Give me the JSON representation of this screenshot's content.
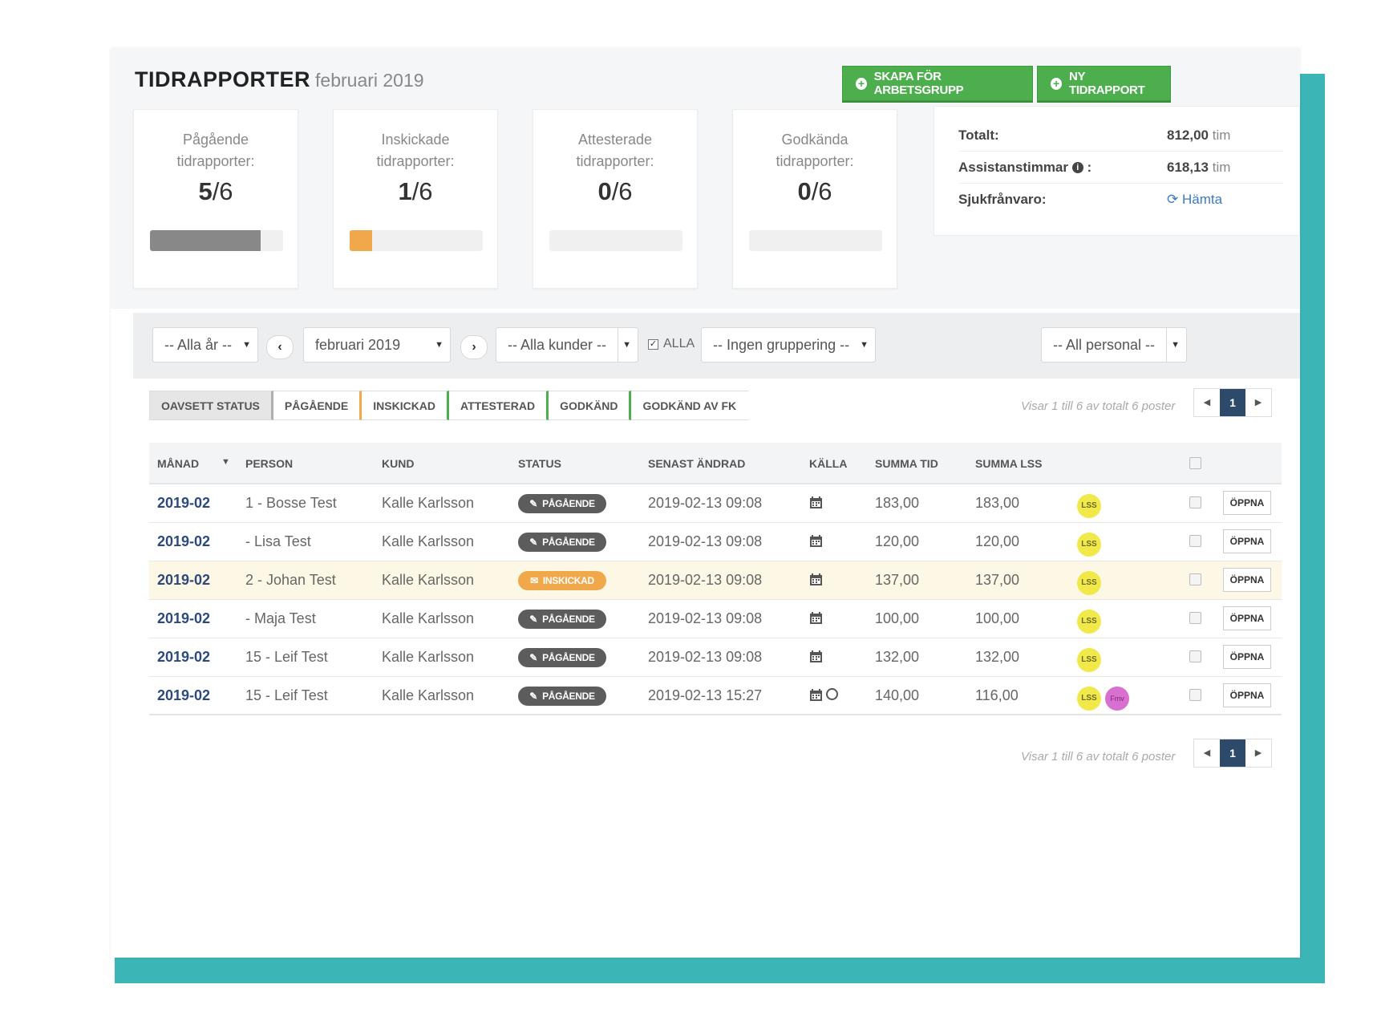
{
  "header": {
    "title": "TIDRAPPORTER",
    "period": "februari 2019",
    "btn_group": "SKAPA FÖR ARBETSGRUPP",
    "btn_new": "NY TIDRAPPORT"
  },
  "stats": [
    {
      "label": "Pågående tidrapporter:",
      "done": "5",
      "total": "/6",
      "progress": 0.83,
      "color": "#888888"
    },
    {
      "label": "Inskickade tidrapporter:",
      "done": "1",
      "total": "/6",
      "progress": 0.17,
      "color": "#f0a84a"
    },
    {
      "label": "Attesterade tidrapporter:",
      "done": "0",
      "total": "/6",
      "progress": 0.0,
      "color": "#888888"
    },
    {
      "label": "Godkända tidrapporter:",
      "done": "0",
      "total": "/6",
      "progress": 0.0,
      "color": "#888888"
    }
  ],
  "summary": {
    "total_label": "Totalt:",
    "total_value": "812,00",
    "assist_label": "Assistanstimmar",
    "assist_value": "618,13",
    "unit": "tim",
    "sick_label": "Sjukfrånvaro:",
    "sick_link": "Hämta"
  },
  "filters": {
    "year": "-- Alla år --",
    "month": "februari 2019",
    "customers": "-- Alla kunder --",
    "all_check": "ALLA",
    "grouping": "-- Ingen gruppering --",
    "staff": "-- All personal --"
  },
  "tabs": [
    "OAVSETT STATUS",
    "PÅGÅENDE",
    "INSKICKAD",
    "ATTESTERAD",
    "GODKÄND",
    "GODKÄND AV FK"
  ],
  "pager": {
    "info": "Visar 1 till 6 av totalt 6 poster",
    "page": "1"
  },
  "columns": [
    "MÅNAD",
    "PERSON",
    "KUND",
    "STATUS",
    "SENAST ÄNDRAD",
    "KÄLLA",
    "SUMMA TID",
    "SUMMA LSS"
  ],
  "rows": [
    {
      "month": "2019-02",
      "person": "1 - Bosse Test",
      "customer": "Kalle Karlsson",
      "status": "PÅGÅENDE",
      "changed": "2019-02-13 09:08",
      "tid": "183,00",
      "lss": "183,00",
      "badge": "LSS",
      "open": "ÖPPNA"
    },
    {
      "month": "2019-02",
      "person": "- Lisa Test",
      "customer": "Kalle Karlsson",
      "status": "PÅGÅENDE",
      "changed": "2019-02-13 09:08",
      "tid": "120,00",
      "lss": "120,00",
      "badge": "LSS",
      "open": "ÖPPNA"
    },
    {
      "month": "2019-02",
      "person": "2 - Johan Test",
      "customer": "Kalle Karlsson",
      "status": "INSKICKAD",
      "changed": "2019-02-13 09:08",
      "tid": "137,00",
      "lss": "137,00",
      "badge": "LSS",
      "open": "ÖPPNA"
    },
    {
      "month": "2019-02",
      "person": "- Maja Test",
      "customer": "Kalle Karlsson",
      "status": "PÅGÅENDE",
      "changed": "2019-02-13 09:08",
      "tid": "100,00",
      "lss": "100,00",
      "badge": "LSS",
      "open": "ÖPPNA"
    },
    {
      "month": "2019-02",
      "person": "15 - Leif Test",
      "customer": "Kalle Karlsson",
      "status": "PÅGÅENDE",
      "changed": "2019-02-13 09:08",
      "tid": "132,00",
      "lss": "132,00",
      "badge": "LSS",
      "open": "ÖPPNA"
    },
    {
      "month": "2019-02",
      "person": "15 - Leif Test",
      "customer": "Kalle Karlsson",
      "status": "PÅGÅENDE",
      "changed": "2019-02-13 15:27",
      "tid": "140,00",
      "lss": "116,00",
      "badge": "LSS",
      "badge2": "Fmv",
      "open": "ÖPPNA"
    }
  ],
  "colors": {
    "teal": "#3bb5b5",
    "green": "#4cae4c",
    "orange": "#f0a84a",
    "navy": "#2d4a6b"
  }
}
